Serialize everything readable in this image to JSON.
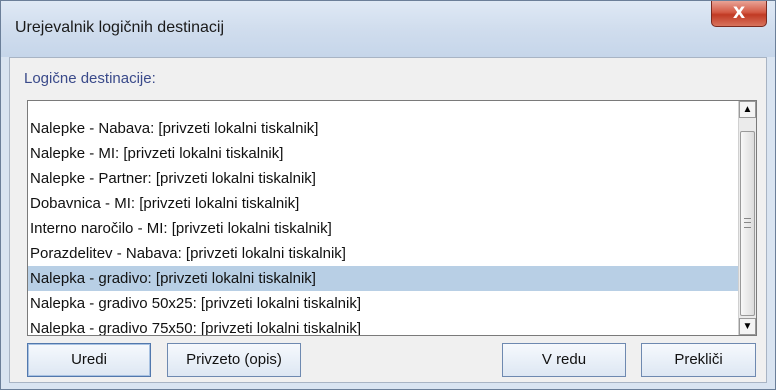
{
  "window": {
    "title": "Urejevalnik logičnih destinacij",
    "close_label": "X"
  },
  "section_label": "Logične destinacije:",
  "list": {
    "items": [
      {
        "label": "Nalepke - Nabava: [privzeti lokalni tiskalnik]"
      },
      {
        "label": "Nalepke - MI: [privzeti lokalni tiskalnik]"
      },
      {
        "label": "Nalepke - Partner: [privzeti lokalni tiskalnik]"
      },
      {
        "label": "Dobavnica - MI: [privzeti lokalni tiskalnik]"
      },
      {
        "label": "Interno naročilo - MI: [privzeti lokalni tiskalnik]"
      },
      {
        "label": "Porazdelitev - Nabava: [privzeti lokalni tiskalnik]"
      },
      {
        "label": "Nalepka - gradivo: [privzeti lokalni tiskalnik]"
      },
      {
        "label": "Nalepka - gradivo 50x25: [privzeti lokalni tiskalnik]"
      },
      {
        "label": "Nalepka - gradivo 75x50: [privzeti lokalni tiskalnik]"
      }
    ],
    "selected_index": 6
  },
  "buttons": {
    "edit": "Uredi",
    "default_desc": "Privzeto (opis)",
    "ok": "V redu",
    "cancel": "Prekliči"
  }
}
